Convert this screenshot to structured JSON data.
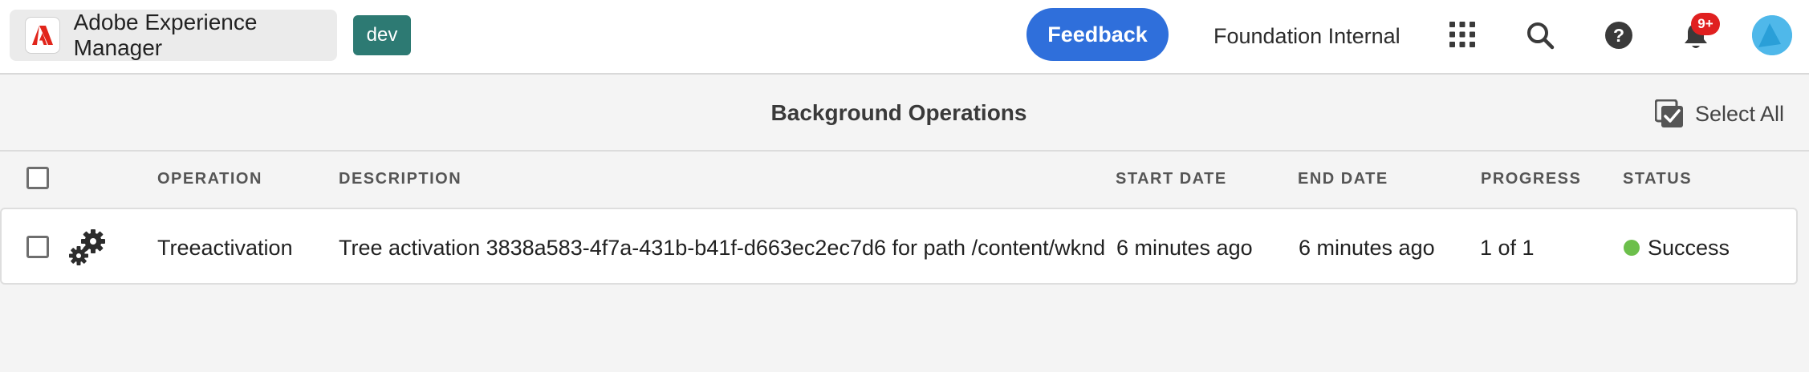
{
  "header": {
    "app_title": "Adobe Experience Manager",
    "environment_badge": "dev",
    "feedback_label": "Feedback",
    "organization": "Foundation Internal",
    "notification_count": "9+",
    "icons": [
      "adobe-logo-icon",
      "apps-grid-icon",
      "search-icon",
      "help-icon",
      "bell-icon",
      "avatar"
    ]
  },
  "titlebar": {
    "title": "Background Operations",
    "select_all_label": "Select All"
  },
  "table": {
    "columns": [
      "OPERATION",
      "DESCRIPTION",
      "START DATE",
      "END DATE",
      "PROGRESS",
      "STATUS"
    ],
    "rows": [
      {
        "operation": "Treeactivation",
        "description": "Tree activation 3838a583-4f7a-431b-b41f-d663ec2ec7d6 for path /content/wknd",
        "start_date": "6 minutes ago",
        "end_date": "6 minutes ago",
        "progress": "1 of 1",
        "status": "Success",
        "status_color": "#6cbf4b"
      }
    ]
  },
  "colors": {
    "feedback_button": "#2f6fdb",
    "env_badge": "#2d7a73",
    "notification_badge": "#e02020",
    "success": "#6cbf4b"
  }
}
